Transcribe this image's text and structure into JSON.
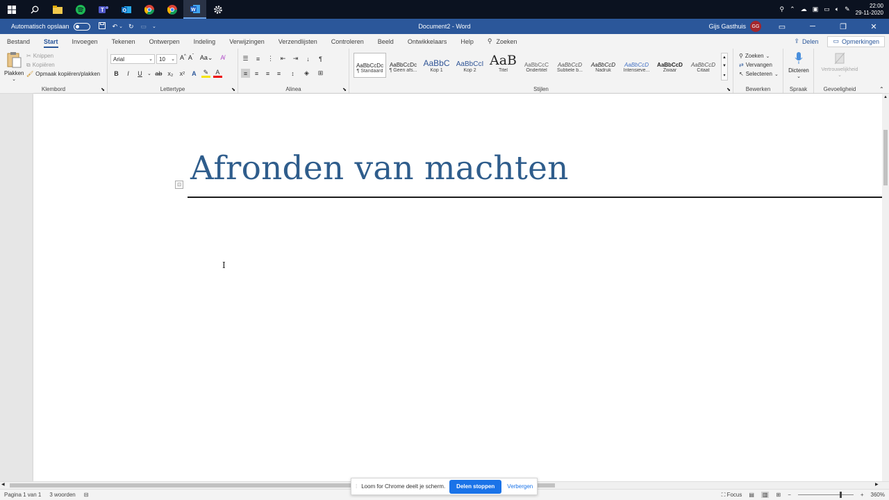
{
  "taskbar": {
    "apps": [
      "start-icon",
      "search-icon",
      "file-explorer-icon",
      "spotify-icon",
      "teams-icon",
      "outlook-icon",
      "chrome-icon",
      "chrome-icon",
      "word-icon",
      "settings-icon"
    ],
    "clock_time": "22:00",
    "clock_date": "29-11-2020"
  },
  "titlebar": {
    "autosave_label": "Automatisch opslaan",
    "document_title": "Document2 - Word",
    "user_name": "Gijs Gasthuis",
    "user_initials": "GG"
  },
  "tabs": [
    "Bestand",
    "Start",
    "Invoegen",
    "Tekenen",
    "Ontwerpen",
    "Indeling",
    "Verwijzingen",
    "Verzendlijsten",
    "Controleren",
    "Beeld",
    "Ontwikkelaars",
    "Help"
  ],
  "active_tab": "Start",
  "search_label": "Zoeken",
  "share_label": "Delen",
  "comments_label": "Opmerkingen",
  "ribbon": {
    "clipboard": {
      "paste": "Plakken",
      "cut": "Knippen",
      "copy": "Kopiëren",
      "format_painter": "Opmaak kopiëren/plakken",
      "label": "Klembord"
    },
    "font": {
      "name": "Arial",
      "size": "10",
      "label": "Lettertype"
    },
    "paragraph": {
      "label": "Alinea"
    },
    "styles": {
      "label": "Stijlen",
      "items": [
        {
          "sample": "AaBbCcDc",
          "name": "¶ Standaard"
        },
        {
          "sample": "AaBbCcDc",
          "name": "¶ Geen afs..."
        },
        {
          "sample": "AaBbC",
          "name": "Kop 1"
        },
        {
          "sample": "AaBbCcI",
          "name": "Kop 2"
        },
        {
          "sample": "AaB",
          "name": "Titel"
        },
        {
          "sample": "AaBbCcC",
          "name": "Ondertitel"
        },
        {
          "sample": "AaBbCcD",
          "name": "Subtiele b..."
        },
        {
          "sample": "AaBbCcD",
          "name": "Nadruk"
        },
        {
          "sample": "AaBbCcD",
          "name": "Intensieve..."
        },
        {
          "sample": "AaBbCcD",
          "name": "Zwaar"
        },
        {
          "sample": "AaBbCcD",
          "name": "Citaat"
        }
      ]
    },
    "editing": {
      "find": "Zoeken",
      "replace": "Vervangen",
      "select": "Selecteren",
      "label": "Bewerken"
    },
    "voice": {
      "dictate": "Dicteren",
      "label": "Spraak"
    },
    "sensitivity": {
      "button": "Vertrouwelijkheid",
      "label": "Gevoeligheid"
    }
  },
  "document": {
    "title_text": "Afronden van machten"
  },
  "statusbar": {
    "page": "Pagina 1 van 1",
    "words": "3 woorden",
    "focus": "Focus",
    "zoom": "360%"
  },
  "loom": {
    "message": "Loom for Chrome deelt je scherm.",
    "stop": "Delen stoppen",
    "hide": "Verbergen"
  },
  "colors": {
    "word_blue": "#2b579a",
    "title_blue": "#2f5d8c",
    "loom_blue": "#1a73e8"
  }
}
